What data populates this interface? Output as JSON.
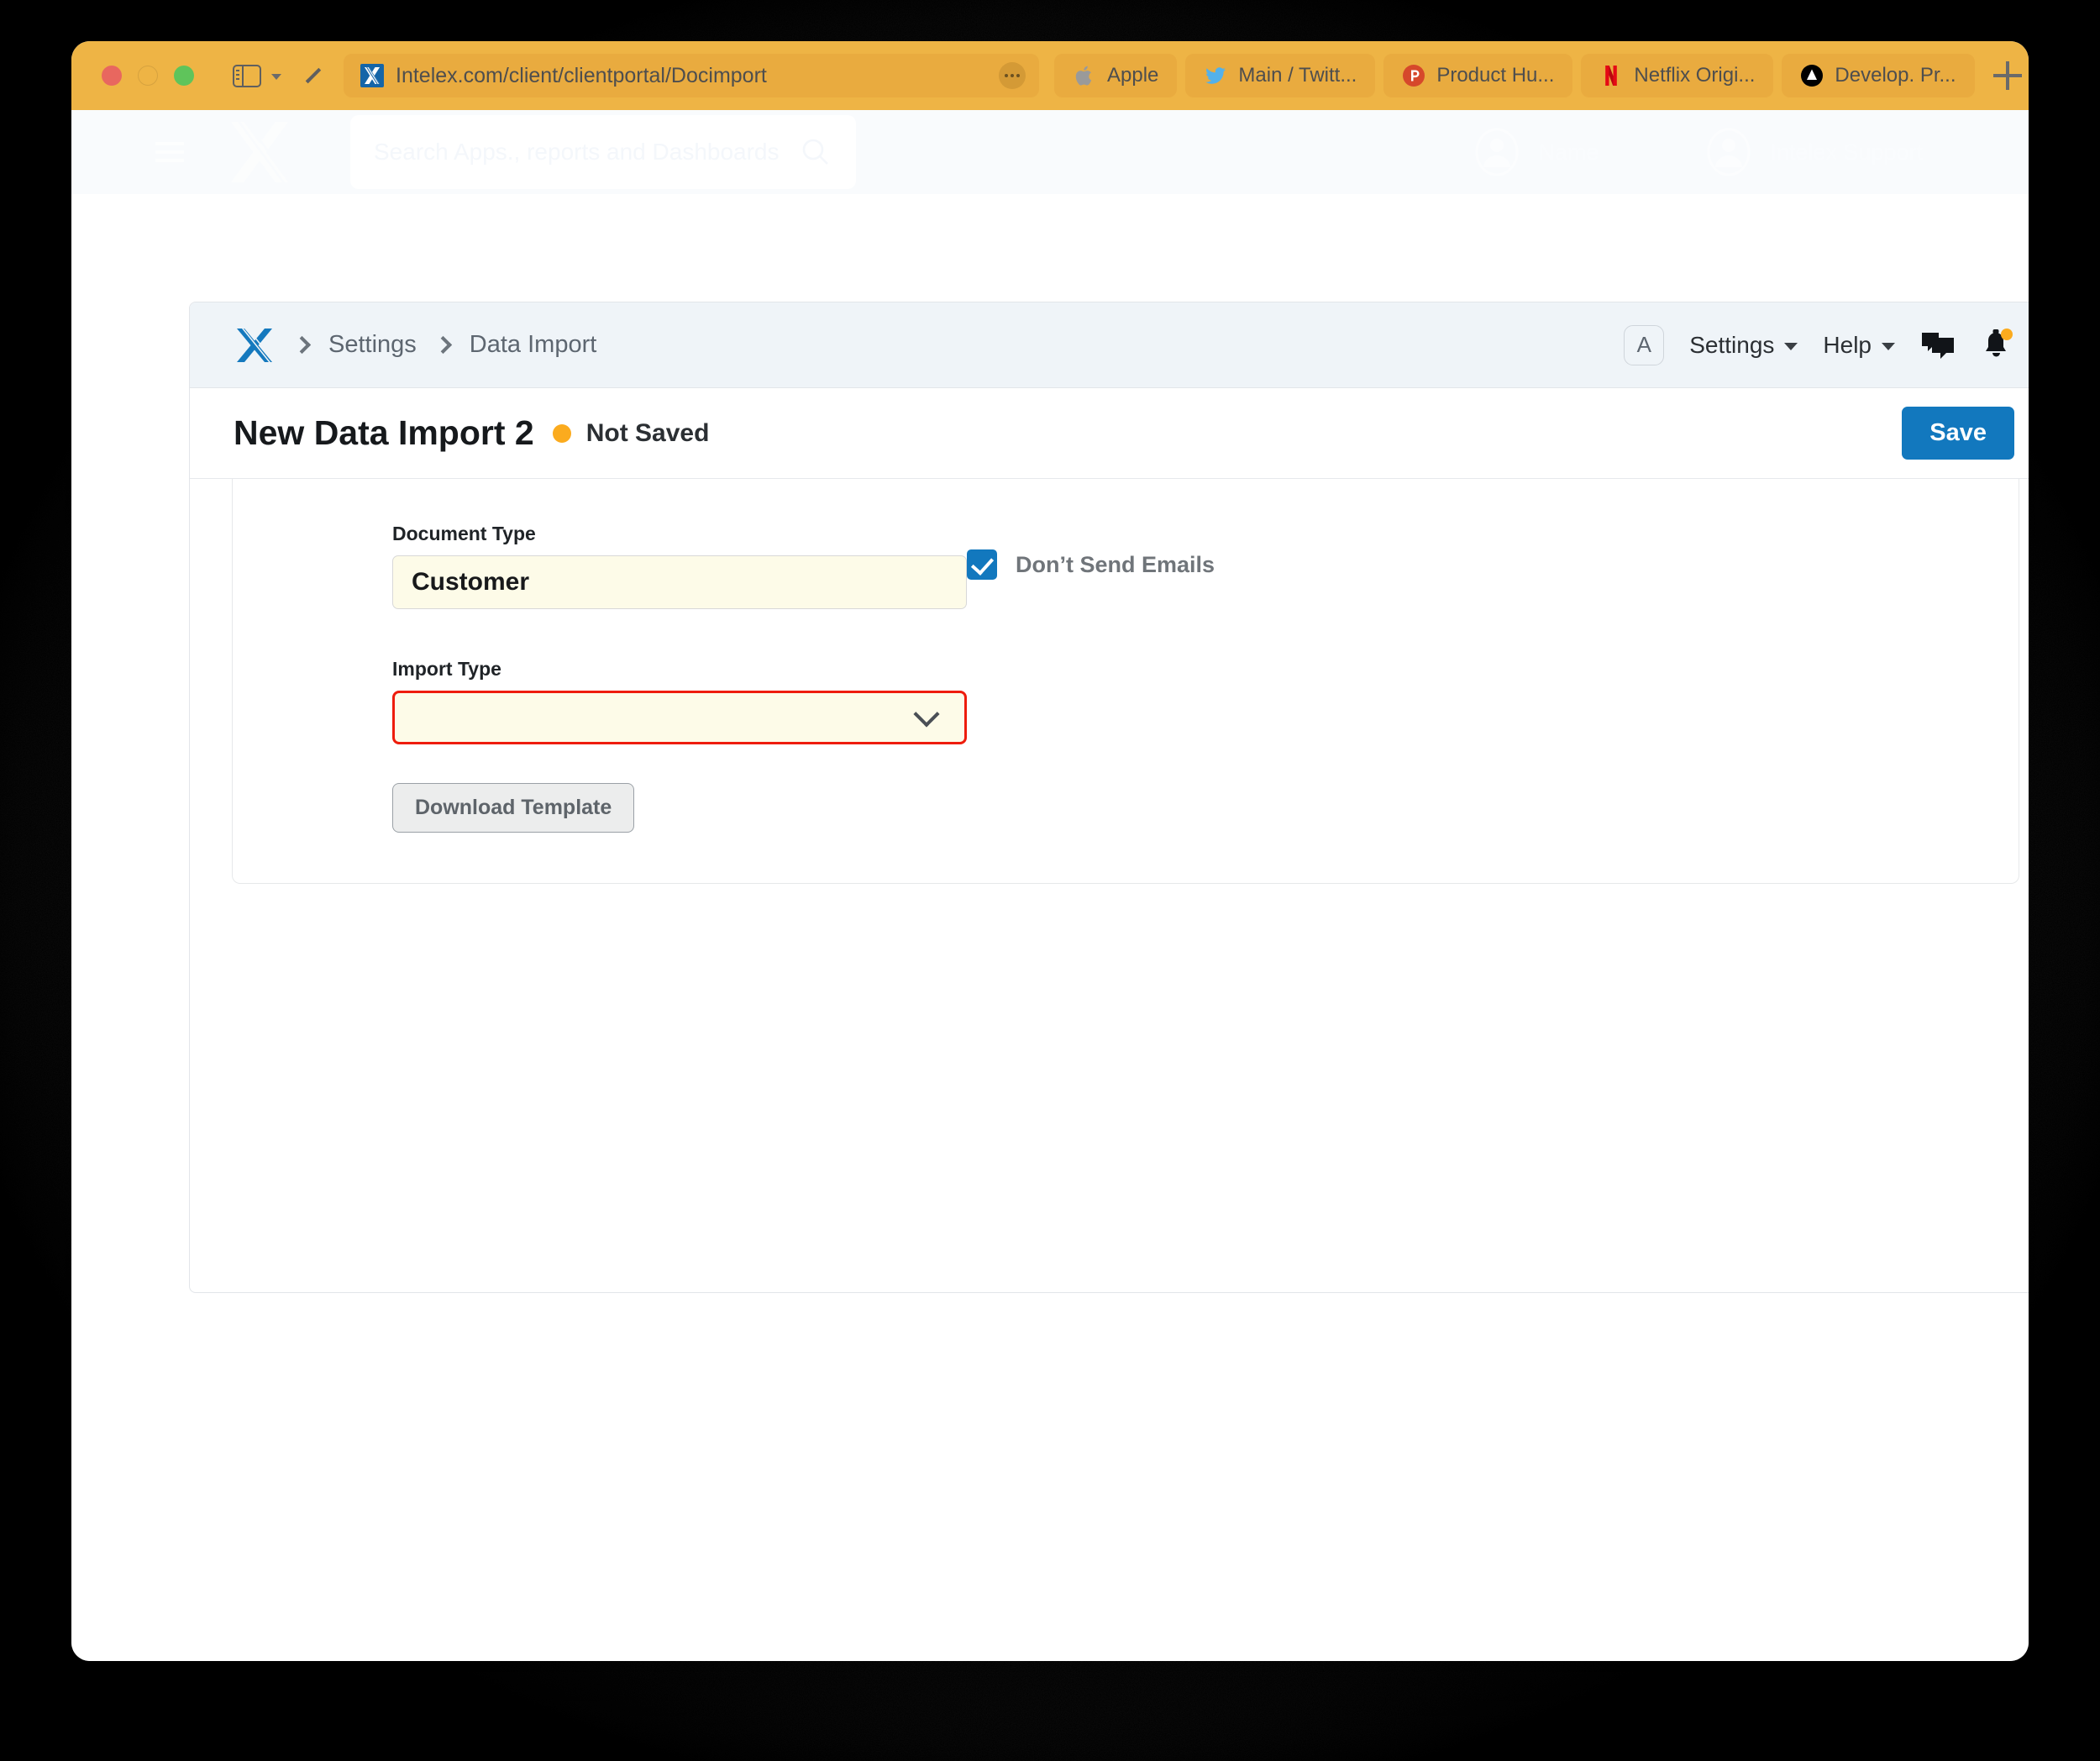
{
  "browser": {
    "url": "Intelex.com/client/clientportal/Docimport",
    "url_favicon": "intelex-icon",
    "more_icon": "ellipsis-icon",
    "back_icon": "back-chevron-icon",
    "sidebar_icon": "sidebar-toggle-icon",
    "new_tab_icon": "plus-icon",
    "traffic_lights": [
      "close",
      "minimize",
      "zoom"
    ],
    "tabs": [
      {
        "label": "Apple",
        "icon": "apple-icon"
      },
      {
        "label": "Main / Twitt...",
        "icon": "twitter-icon"
      },
      {
        "label": "Product Hu...",
        "icon": "producthunt-icon"
      },
      {
        "label": "Netflix Origi...",
        "icon": "netflix-icon"
      },
      {
        "label": "Develop. Pr...",
        "icon": "dropbox-icon"
      }
    ]
  },
  "global_nav": {
    "menu_icon": "hamburger-icon",
    "logo_icon": "intelex-logo-icon",
    "search_placeholder": "Search Apps., reports and Dashboards",
    "search_icon": "search-icon",
    "user_name": "Name",
    "support_name": "Intelex Support",
    "user_icon": "user-avatar-icon",
    "support_icon": "user-avatar-icon"
  },
  "breadcrumb": {
    "home_icon": "intelex-logo-icon",
    "items": [
      "Settings",
      "Data Import"
    ],
    "avatar_initial": "A",
    "settings_label": "Settings",
    "help_label": "Help",
    "chat_icon": "chat-bubbles-icon",
    "bell_icon": "notification-bell-icon",
    "bell_badge_color": "#fbab1e"
  },
  "header": {
    "title": "New Data Import 2",
    "status": "Not Saved",
    "status_color": "#fbab1e",
    "save_label": "Save",
    "save_color": "#1278be"
  },
  "form": {
    "document_type": {
      "label": "Document Type",
      "value": "Customer"
    },
    "import_type": {
      "label": "Import Type",
      "value": "",
      "has_error": true,
      "error_color": "#ee1c0c",
      "chevron_icon": "chevron-down-icon"
    },
    "download_template_label": "Download Template",
    "dont_send_emails": {
      "label": "Don’t Send Emails",
      "checked": true,
      "check_icon": "checkmark-icon"
    }
  }
}
